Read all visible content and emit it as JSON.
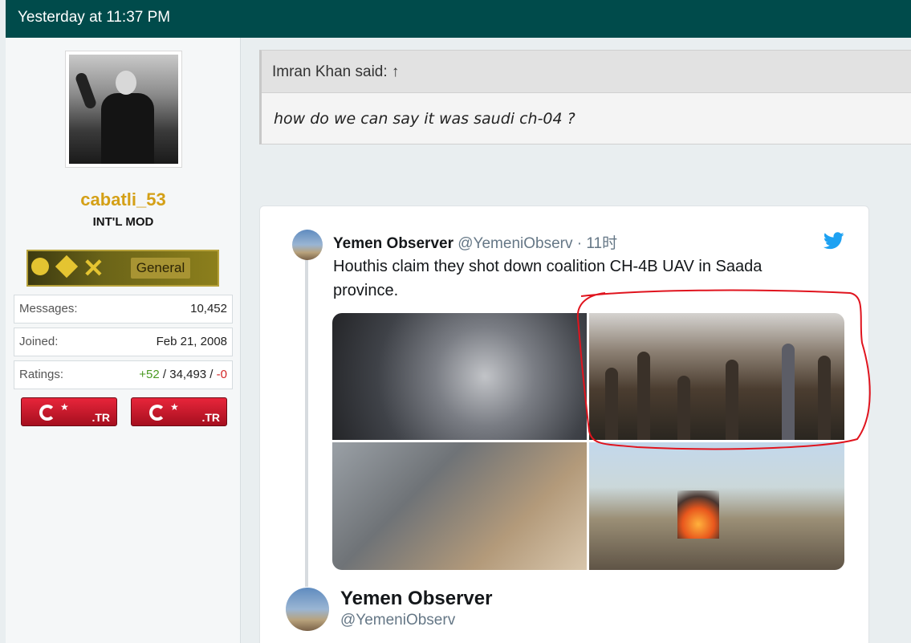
{
  "post": {
    "timestamp": "Yesterday at 11:37 PM"
  },
  "user": {
    "name": "cabatli_53",
    "title": "INT'L MOD",
    "rank_label": "General",
    "stats": {
      "messages_label": "Messages:",
      "messages_value": "10,452",
      "joined_label": "Joined:",
      "joined_value": "Feb 21, 2008",
      "ratings_label": "Ratings:",
      "ratings_pos": "+52",
      "ratings_sep1": " / ",
      "ratings_total": "34,493",
      "ratings_sep2": " / ",
      "ratings_neg": "-0"
    },
    "flags": [
      ".TR",
      ".TR"
    ]
  },
  "quote": {
    "attribution": "Imran Khan said: ↑",
    "text": "how do we can say it was saudi ch-04 ?"
  },
  "tweet": {
    "name": "Yemen Observer",
    "handle": "@YemeniObserv",
    "dot": " · ",
    "time": "11时",
    "text": "Houthis claim they shot down coalition CH-4B UAV in Saada province."
  },
  "tweet_author_card": {
    "name": "Yemen Observer",
    "handle": "@YemeniObserv"
  },
  "colors": {
    "header_bg": "#004b4b",
    "username": "#d4a017",
    "twitter_blue": "#1da1f2",
    "annotation_red": "#e0141e"
  }
}
